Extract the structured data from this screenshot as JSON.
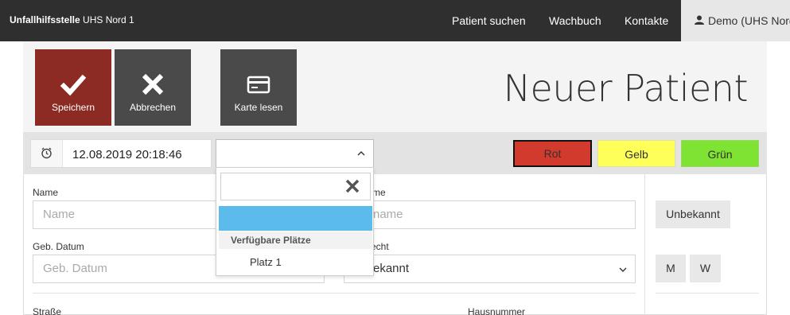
{
  "navbar": {
    "brand_bold": "Unfallhilfsstelle",
    "brand_rest": " UHS Nord 1",
    "links": [
      "Patient suchen",
      "Wachbuch",
      "Kontakte"
    ],
    "user": "Demo (UHS Nord"
  },
  "actions": {
    "save": "Speichern",
    "cancel": "Abbrechen",
    "card": "Karte lesen"
  },
  "page_title": "Neuer Patient",
  "header": {
    "datetime": "12.08.2019 20:18:46",
    "triage": [
      "Rot",
      "Gelb",
      "Grün"
    ]
  },
  "dropdown": {
    "search_value": "",
    "group_label": "Verfügbare Plätze",
    "options": [
      "Platz 1"
    ]
  },
  "form": {
    "name_label": "Name",
    "name_placeholder": "Name",
    "firstname_label_visible": "me",
    "firstname_placeholder_visible": "name",
    "birthdate_label": "Geb. Datum",
    "birthdate_placeholder": "Geb. Datum",
    "gender_label_visible": "echt",
    "gender_value_visible": "ekannt",
    "street_label": "Straße",
    "housenumber_label": "Hausnummer"
  },
  "side": {
    "unknown": "Unbekannt",
    "male": "M",
    "female": "W"
  },
  "colors": {
    "navbar": "#2f2f2f",
    "save": "#8b2b23",
    "secondary": "#4a4a4a",
    "red": "#d23a2d",
    "yellow": "#ffff5a",
    "green": "#7fe333",
    "highlight": "#5bbbed"
  }
}
